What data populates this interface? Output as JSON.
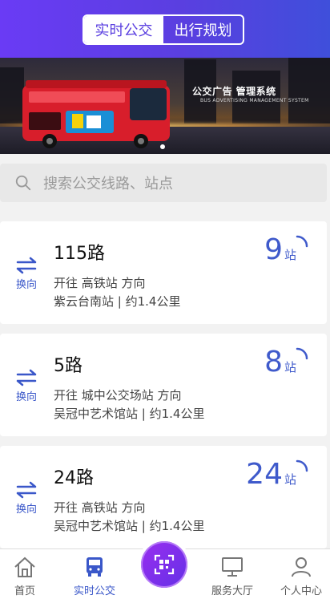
{
  "header": {
    "tabs": [
      {
        "label": "实时公交",
        "active": true
      },
      {
        "label": "出行规划",
        "active": false
      }
    ]
  },
  "banner": {
    "title": "公交广告 管理系统",
    "subtitle": "BUS ADVERTISING MANAGEMENT SYSTEM"
  },
  "search": {
    "placeholder": "搜索公交线路、站点"
  },
  "routes": [
    {
      "swap_label": "换向",
      "name": "115路",
      "direction": "开往 高铁站 方向",
      "stop": "紫云台南站 | 约1.4公里",
      "stations": "9",
      "unit": "站"
    },
    {
      "swap_label": "换向",
      "name": "5路",
      "direction": "开往 城中公交场站 方向",
      "stop": "吴冠中艺术馆站 | 约1.4公里",
      "stations": "8",
      "unit": "站"
    },
    {
      "swap_label": "换向",
      "name": "24路",
      "direction": "开往 高铁站 方向",
      "stop": "吴冠中艺术馆站 | 约1.4公里",
      "stations": "24",
      "unit": "站"
    }
  ],
  "nav": {
    "items": [
      {
        "label": "首页",
        "icon": "home-icon"
      },
      {
        "label": "实时公交",
        "icon": "bus-icon",
        "active": true
      },
      {
        "label": "服务大厅",
        "icon": "monitor-icon"
      },
      {
        "label": "个人中心",
        "icon": "user-icon"
      }
    ],
    "center_icon": "scan-icon"
  },
  "colors": {
    "primary": "#5a3fe0",
    "accent_blue": "#3f5acb",
    "scan_purple": "#8a2ff0"
  }
}
